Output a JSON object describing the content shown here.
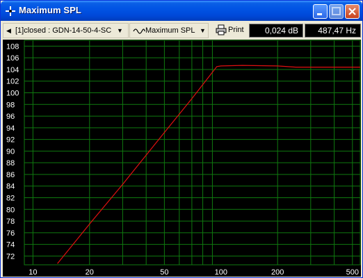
{
  "window": {
    "title": "Maximum SPL",
    "icon": "crosshair-icon",
    "buttons": [
      "minimize-icon",
      "maximize-icon",
      "close-icon"
    ]
  },
  "toolbar": {
    "speaker_selector": "[1]closed : GDN-14-50-4-SC",
    "mode_selector": "Maximum SPL",
    "print_label": "Print",
    "readout_db": "0,024 dB",
    "readout_hz": "487,47 Hz"
  },
  "colors": {
    "grid": "#0f7a0f",
    "curve": "#e01010",
    "background": "#000000"
  },
  "chart_data": {
    "type": "line",
    "x_scale": "log",
    "xlim": [
      9,
      550
    ],
    "ylim": [
      70.5,
      109
    ],
    "x_tick_labels": [
      "10",
      "20",
      "50",
      "100",
      "200",
      "500"
    ],
    "y_tick_labels": [
      "72",
      "74",
      "76",
      "78",
      "80",
      "82",
      "84",
      "86",
      "88",
      "90",
      "92",
      "94",
      "96",
      "98",
      "100",
      "102",
      "104",
      "106",
      "108"
    ],
    "grid": true,
    "series": [
      {
        "x": [
          13.5,
          20,
          30,
          50,
          70,
          95,
          100,
          130,
          200,
          250,
          300,
          400,
          550
        ],
        "y": [
          70.7,
          77.5,
          84.3,
          93.2,
          99.0,
          104.5,
          104.6,
          104.7,
          104.6,
          104.4,
          104.4,
          104.4,
          104.4
        ]
      }
    ]
  }
}
